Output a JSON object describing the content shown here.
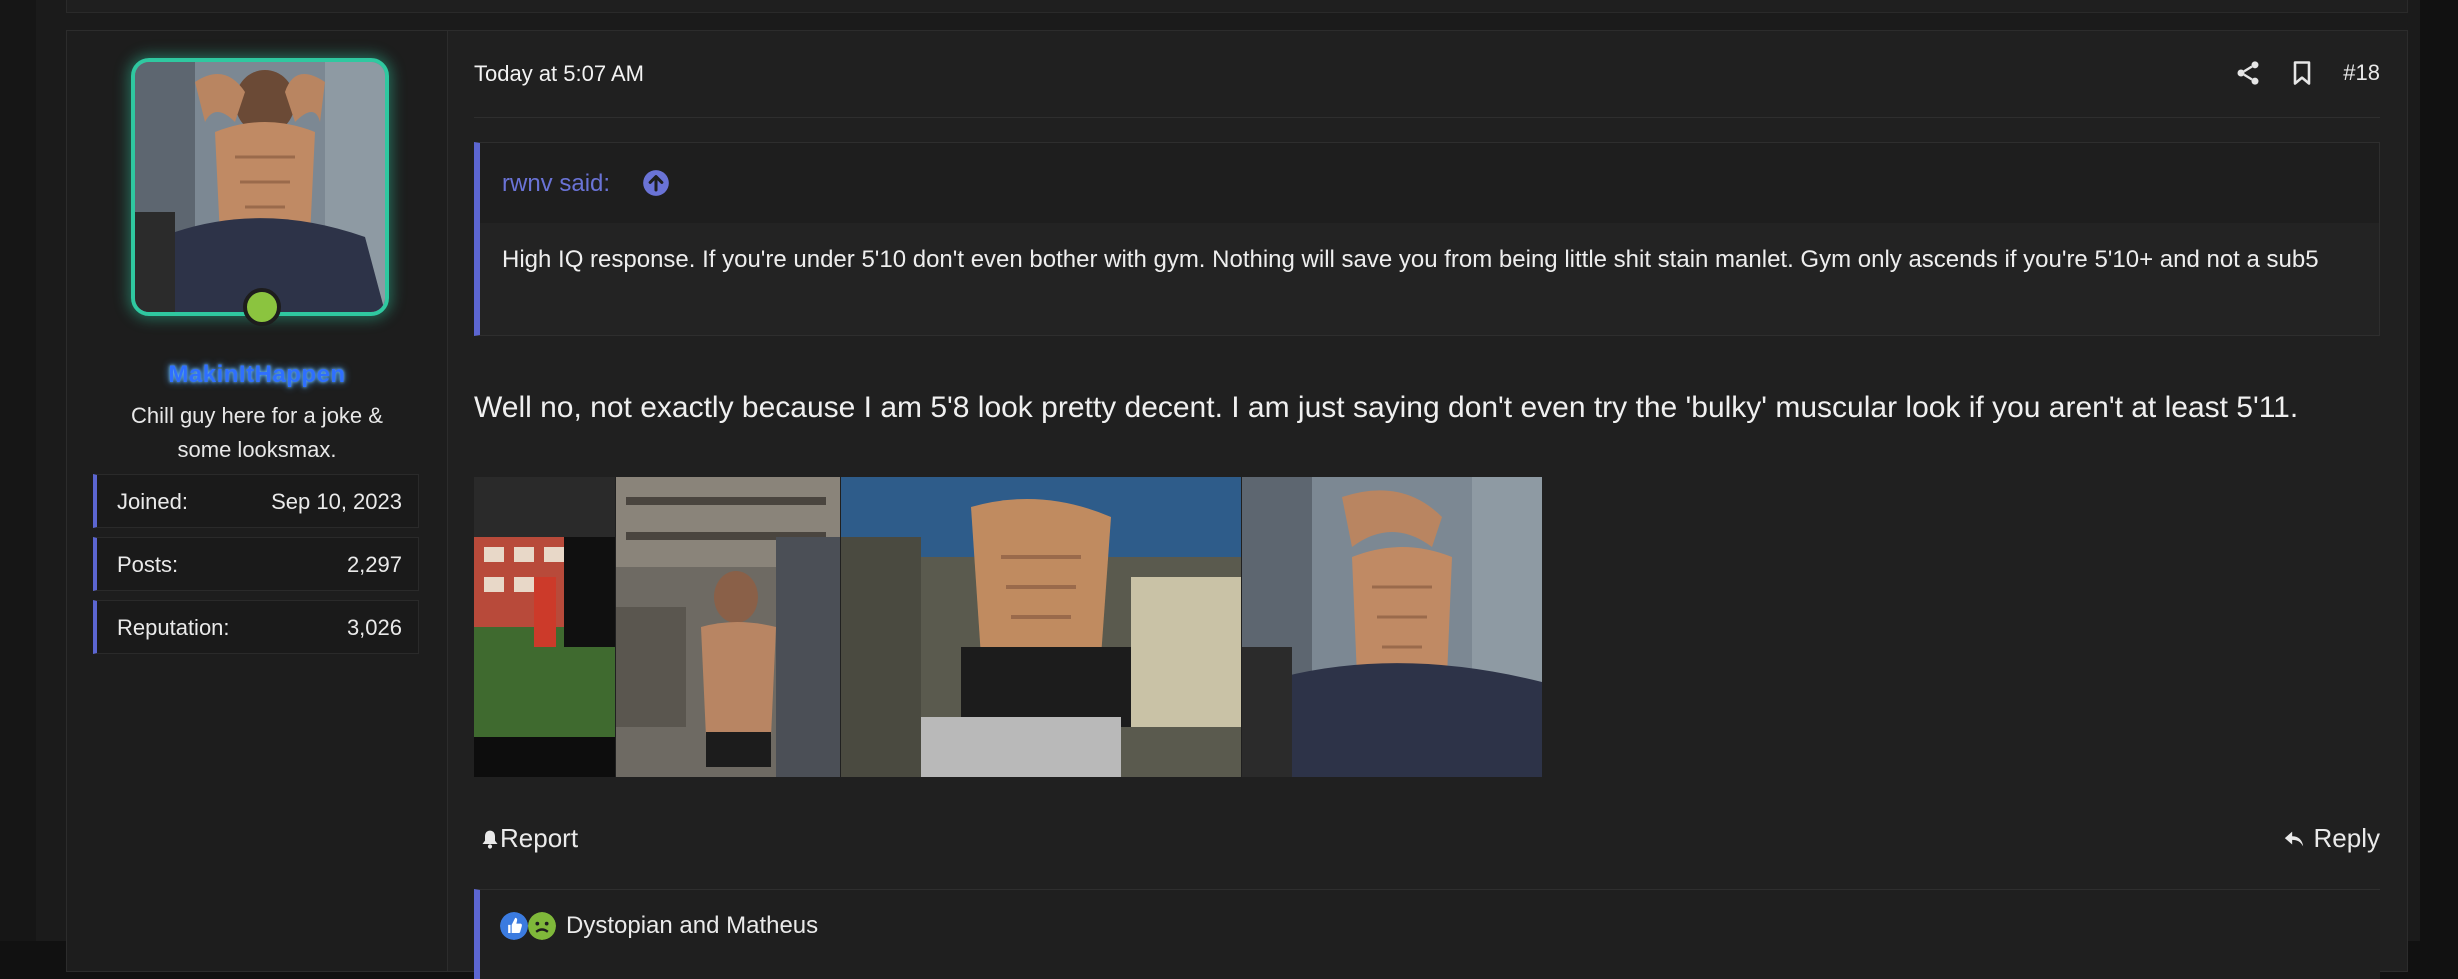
{
  "post": {
    "date": "Today at 5:07 AM",
    "number": "#18",
    "header_icons": [
      "share-icon",
      "bookmark-icon"
    ]
  },
  "user": {
    "name": "MakinItHappen",
    "title": "Chill guy here for a joke & some looksmax.",
    "online": true,
    "stats": [
      {
        "label": "Joined:",
        "value": "Sep 10, 2023"
      },
      {
        "label": "Posts:",
        "value": "2,297"
      },
      {
        "label": "Reputation:",
        "value": "3,026"
      }
    ]
  },
  "quote": {
    "author": "rwnv said:",
    "text": "High IQ response. If you're under 5'10 don't even bother with gym. Nothing will save you from being little shit stain manlet. Gym only ascends if you're 5'10+ and not a sub5"
  },
  "message": "Well no, not exactly because I am 5'8 look pretty decent. I am just saying don't even try the 'bulky' muscular look if you aren't at least 5'11.",
  "images": [
    "attached-photo-1",
    "attached-photo-2",
    "attached-photo-3",
    "attached-photo-4"
  ],
  "actions": {
    "report": "Report",
    "reply": "Reply"
  },
  "reactions": {
    "icons": [
      "like-icon",
      "nauseated-icon"
    ],
    "names": "Dystopian and Matheus"
  },
  "colors": {
    "accent": "#5c66d1",
    "avatar_glow": "#2fc8a0",
    "online": "#8bc43f",
    "username": "#2f6fff"
  }
}
